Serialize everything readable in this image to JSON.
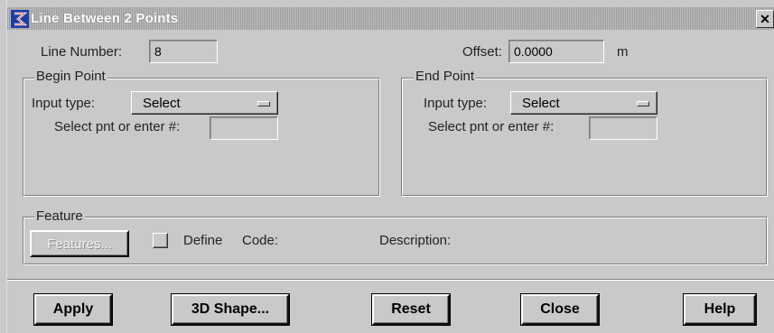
{
  "window": {
    "title": "Line Between 2 Points",
    "app_icon": "logo-icon",
    "close_glyph": "✕"
  },
  "header": {
    "line_number_label": "Line Number:",
    "line_number_value": "8",
    "offset_label": "Offset:",
    "offset_value": "0.0000",
    "offset_unit": "m"
  },
  "begin_point": {
    "title": "Begin Point",
    "input_type_label": "Input type:",
    "input_type_value": "Select",
    "select_label": "Select pnt or enter #:",
    "select_value": ""
  },
  "end_point": {
    "title": "End Point",
    "input_type_label": "Input type:",
    "input_type_value": "Select",
    "select_label": "Select pnt or enter #:",
    "select_value": ""
  },
  "feature": {
    "title": "Feature",
    "features_button": "Features...",
    "define_label": "Define",
    "define_checked": false,
    "code_label": "Code:",
    "description_label": "Description:"
  },
  "buttons": {
    "apply": "Apply",
    "shape3d": "3D Shape...",
    "reset": "Reset",
    "close": "Close",
    "help": "Help"
  }
}
